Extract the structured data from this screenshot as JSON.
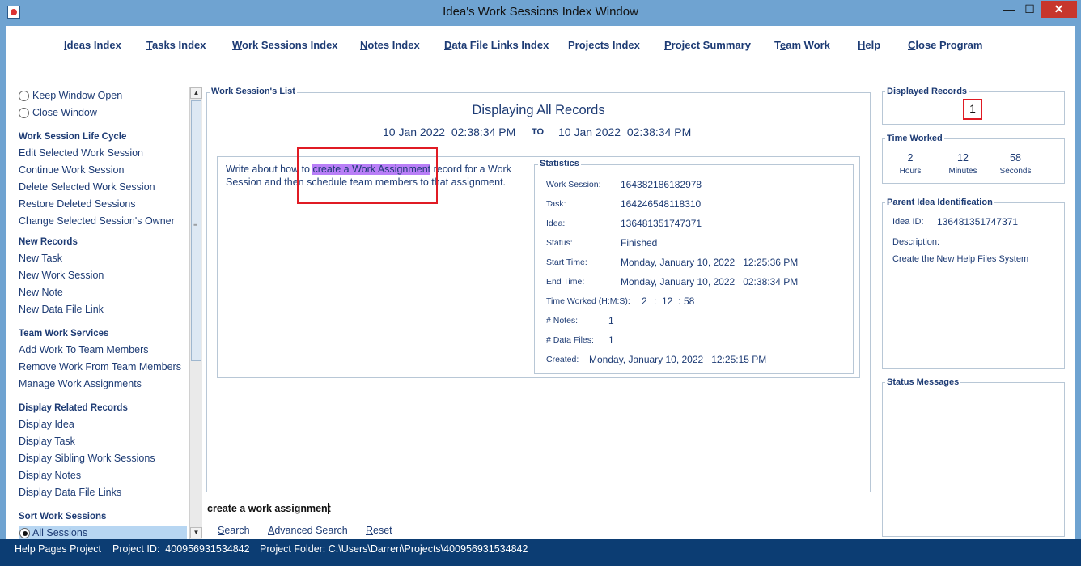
{
  "window": {
    "title": "Idea's Work Sessions Index Window",
    "minimize": "—",
    "maximize": "☐",
    "close": "✕"
  },
  "menu": [
    {
      "u": "I",
      "rest": "deas Index"
    },
    {
      "u": "T",
      "rest": "asks Index"
    },
    {
      "u": "W",
      "rest": "ork Sessions Index"
    },
    {
      "u": "N",
      "rest": "otes Index"
    },
    {
      "u": "D",
      "rest": "ata File Links Index"
    },
    {
      "u": "",
      "rest": "Projects Index"
    },
    {
      "u": "P",
      "rest": "roject Summary"
    },
    {
      "pre": "T",
      "u": "e",
      "rest": "am Work"
    },
    {
      "u": "H",
      "rest": "elp"
    },
    {
      "u": "C",
      "rest": "lose Program"
    }
  ],
  "sidebar": {
    "keep_open": {
      "u": "K",
      "rest": "eep Window Open"
    },
    "close_window": {
      "u": "C",
      "rest": "lose Window"
    },
    "life_cycle_head": "Work Session Life Cycle",
    "life_cycle": [
      "Edit Selected Work Session",
      "Continue Work Session",
      "Delete Selected Work Session",
      "Restore Deleted Sessions",
      "Change Selected Session's Owner"
    ],
    "new_records_head": "New Records",
    "new_records": [
      "New Task",
      "New Work Session",
      "New Note",
      "New Data File Link"
    ],
    "team_head": "Team Work Services",
    "team": [
      "Add Work To Team Members",
      "Remove Work From Team Members",
      "Manage Work Assignments"
    ],
    "display_head": "Display Related Records",
    "display": [
      "Display Idea",
      "Display Task",
      "Display Sibling Work Sessions",
      "Display Notes",
      "Display Data File Links"
    ],
    "sort_head": "Sort Work Sessions",
    "sort_selected": "All Sessions"
  },
  "list": {
    "group_label": "Work Session's List",
    "heading": "Displaying All Records",
    "from_date": "10 Jan 2022",
    "from_time": "02:38:34 PM",
    "to_label": "TO",
    "to_date": "10 Jan 2022",
    "to_time": "02:38:34 PM",
    "desc_before": "Write about how to ",
    "desc_highlight": "create a Work Assignment",
    "desc_after": " record for a Work Session and then schedule team members to that assignment."
  },
  "statistics": {
    "label": "Statistics",
    "work_session_label": "Work Session:",
    "work_session": "164382186182978",
    "task_label": "Task:",
    "task": "164246548118310",
    "idea_label": "Idea:",
    "idea": "136481351747371",
    "status_label": "Status:",
    "status": "Finished",
    "start_label": "Start Time:",
    "start": "Monday, January 10, 2022   12:25:36 PM",
    "end_label": "End Time:",
    "end": "Monday, January 10, 2022   02:38:34 PM",
    "tw_label": "Time Worked (H:M:S):",
    "tw_h": "2",
    "tw_m": "12",
    "tw_s": "58",
    "colon": ":",
    "notes_label": "# Notes:",
    "notes": "1",
    "files_label": "# Data Files:",
    "files": "1",
    "created_label": "Created:",
    "created": "Monday, January 10, 2022   12:25:15 PM"
  },
  "search": {
    "value": "create a work assignment",
    "search_btn": {
      "u": "S",
      "rest": "earch"
    },
    "advanced_btn": {
      "u": "A",
      "rest": "dvanced Search"
    },
    "reset_btn": {
      "u": "R",
      "rest": "eset"
    }
  },
  "right": {
    "displayed_label": "Displayed Records",
    "displayed_count": "1",
    "time_label": "Time Worked",
    "hours": "2",
    "hours_label": "Hours",
    "minutes": "12",
    "minutes_label": "Minutes",
    "seconds": "58",
    "seconds_label": "Seconds",
    "parent_label": "Parent Idea Identification",
    "idea_id_label": "Idea ID:",
    "idea_id": "136481351747371",
    "desc_label": "Description:",
    "desc": "Create the New Help Files System",
    "status_msgs_label": "Status Messages"
  },
  "statusbar": {
    "project": "Help Pages Project",
    "project_id": "Project ID:  400956931534842",
    "folder": "Project Folder: C:\\Users\\Darren\\Projects\\400956931534842"
  },
  "colors": {
    "accent": "#1d3b74",
    "frame": "#6fa3d1",
    "statusbar": "#0c3d73",
    "highlight": "#b97ef7",
    "annotation": "#e01b24"
  }
}
